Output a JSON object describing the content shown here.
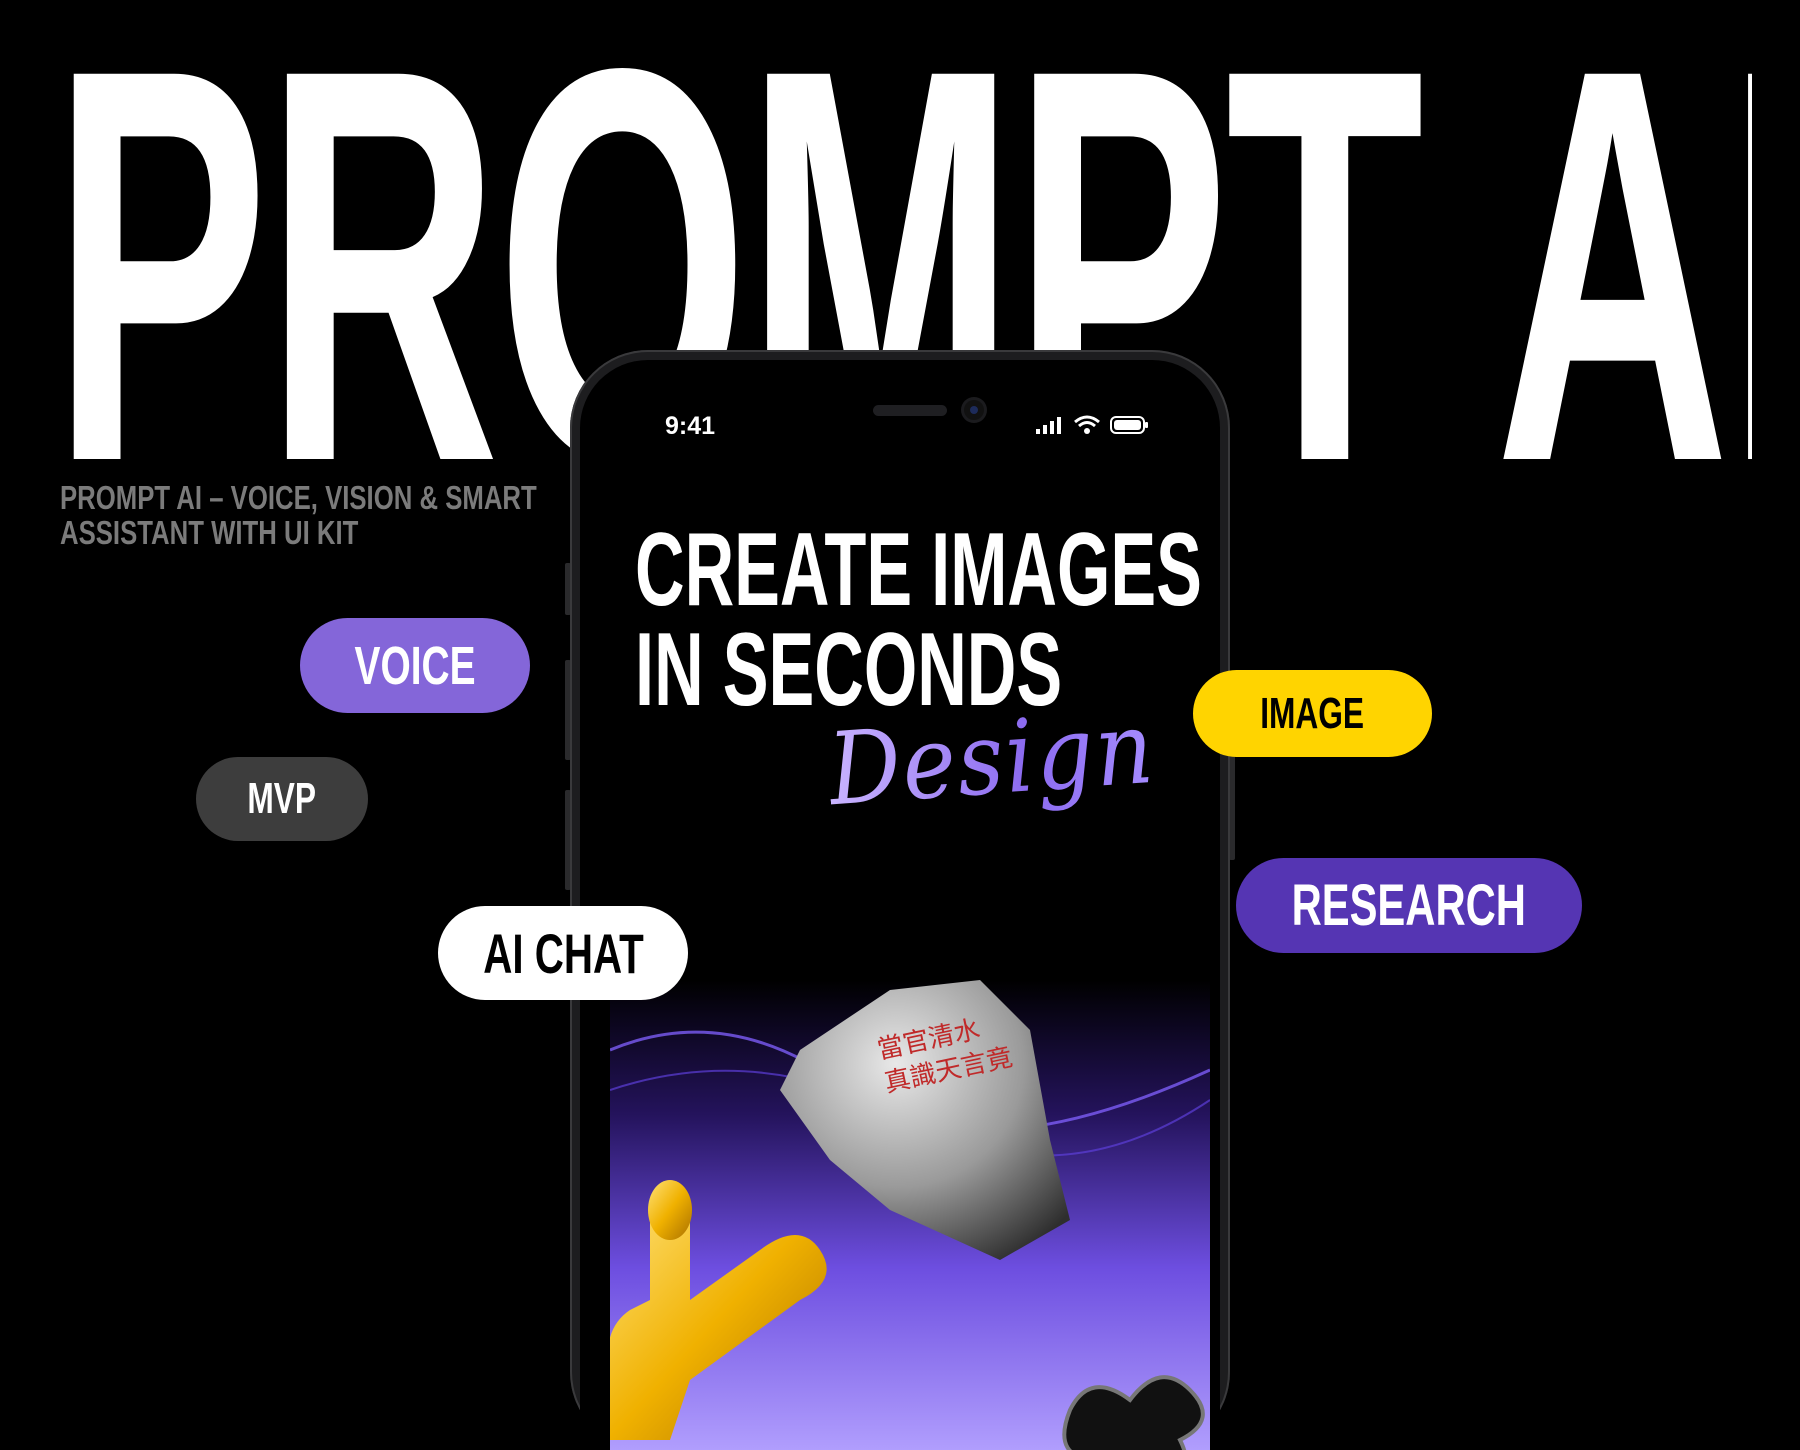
{
  "hero": {
    "title": "PROMPT AI"
  },
  "subtitle": {
    "line1": "PROMPT AI – VOICE, VISION & SMART",
    "line2": "ASSISTANT WITH UI KIT"
  },
  "tags": {
    "voice": "VOICE",
    "mvp": "MVP",
    "ai_chat": "AI CHAT",
    "image": "IMAGE",
    "research": "RESEARCH"
  },
  "phone": {
    "status_time": "9:41",
    "heading_line1": "CREATE IMAGES",
    "heading_line2": "IN SECONDS",
    "script_word": "Design",
    "rock_text_line1": "當官清水",
    "rock_text_line2": "真識天言竟"
  },
  "colors": {
    "background": "#000000",
    "voice_pill": "#8466d9",
    "mvp_pill": "#3d3d3d",
    "ai_chat_pill": "#ffffff",
    "image_pill": "#ffd400",
    "research_pill": "#5535b3"
  },
  "icons": [
    "signal-icon",
    "wifi-icon",
    "battery-icon"
  ]
}
